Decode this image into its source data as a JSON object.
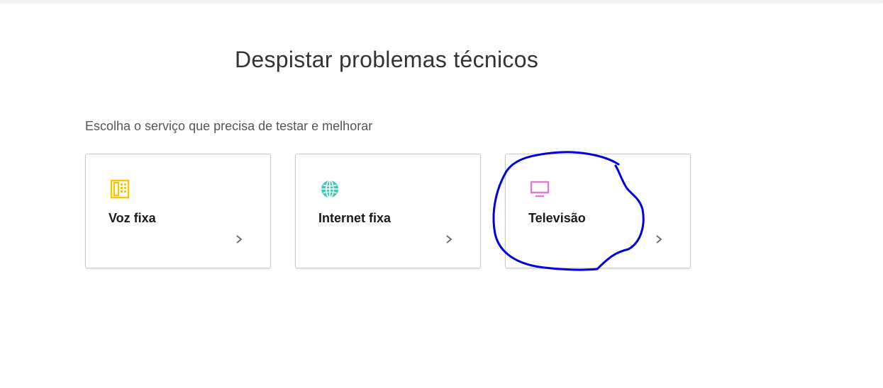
{
  "page": {
    "title": "Despistar problemas técnicos",
    "subtitle": "Escolha o serviço que precisa de testar e melhorar"
  },
  "cards": [
    {
      "label": "Voz fixa",
      "icon": "landline-phone-icon",
      "color": "#f5c800"
    },
    {
      "label": "Internet fixa",
      "icon": "globe-icon",
      "color": "#3dc7b4"
    },
    {
      "label": "Televisão",
      "icon": "tv-icon",
      "color": "#e07ad0"
    }
  ],
  "colors": {
    "annotation": "#0000dd",
    "chevron": "#555555",
    "card_border": "#c9c9c9"
  }
}
